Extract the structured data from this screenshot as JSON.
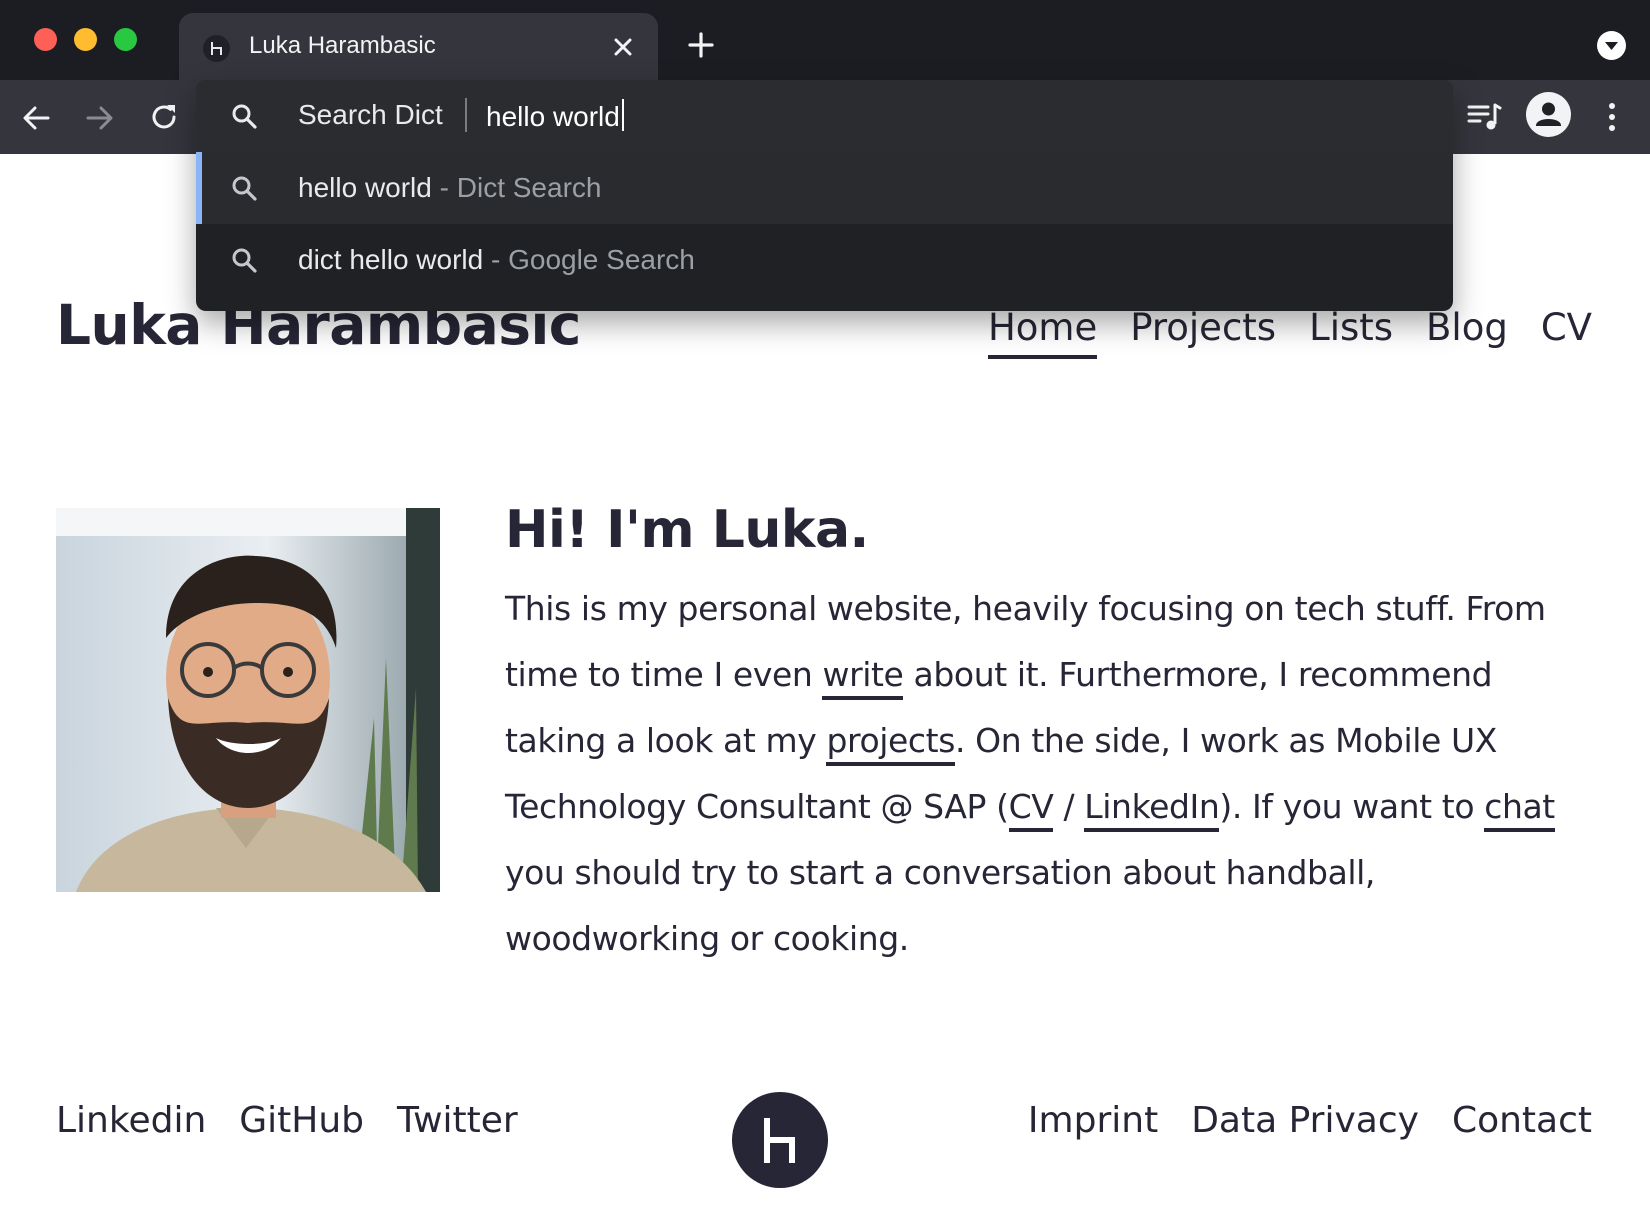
{
  "browser": {
    "tab_title": "Luka Harambasic",
    "omnibox": {
      "keyword_label": "Search Dict",
      "query": "hello world",
      "suggestions": [
        {
          "text": "hello world",
          "separator": " - ",
          "source": "Dict Search",
          "selected": true
        },
        {
          "text": "dict hello world",
          "separator": " - ",
          "source": "Google Search",
          "selected": false
        }
      ]
    }
  },
  "site": {
    "title": "Luka Harambasic",
    "nav": [
      "Home",
      "Projects",
      "Lists",
      "Blog",
      "CV"
    ],
    "active_nav": "Home",
    "greeting": "Hi! I'm Luka.",
    "intro": {
      "p1": "This is my personal website, heavily focusing on tech stuff. From time to time I even ",
      "link_write": "write",
      "p2": " about it. Furthermore, I recommend taking a look at my ",
      "link_projects": "projects",
      "p3": ". On the side, I work as Mobile UX Technology Consultant @ SAP (",
      "link_cv": "CV",
      "p4": " / ",
      "link_linkedin": "LinkedIn",
      "p5": "). If you want to ",
      "link_chat": "chat",
      "p6": " you should try to start a conversation about handball, woodworking or cooking."
    },
    "footer": {
      "left_links": [
        "Linkedin",
        "GitHub",
        "Twitter"
      ],
      "right_links": [
        "Imprint",
        "Data Privacy",
        "Contact"
      ]
    }
  },
  "colors": {
    "text": "#262636",
    "chrome_dark": "#1c1d22",
    "chrome_toolbar": "#35363d",
    "omnibox_bg": "#202124",
    "selection_accent": "#8ab4f8"
  }
}
